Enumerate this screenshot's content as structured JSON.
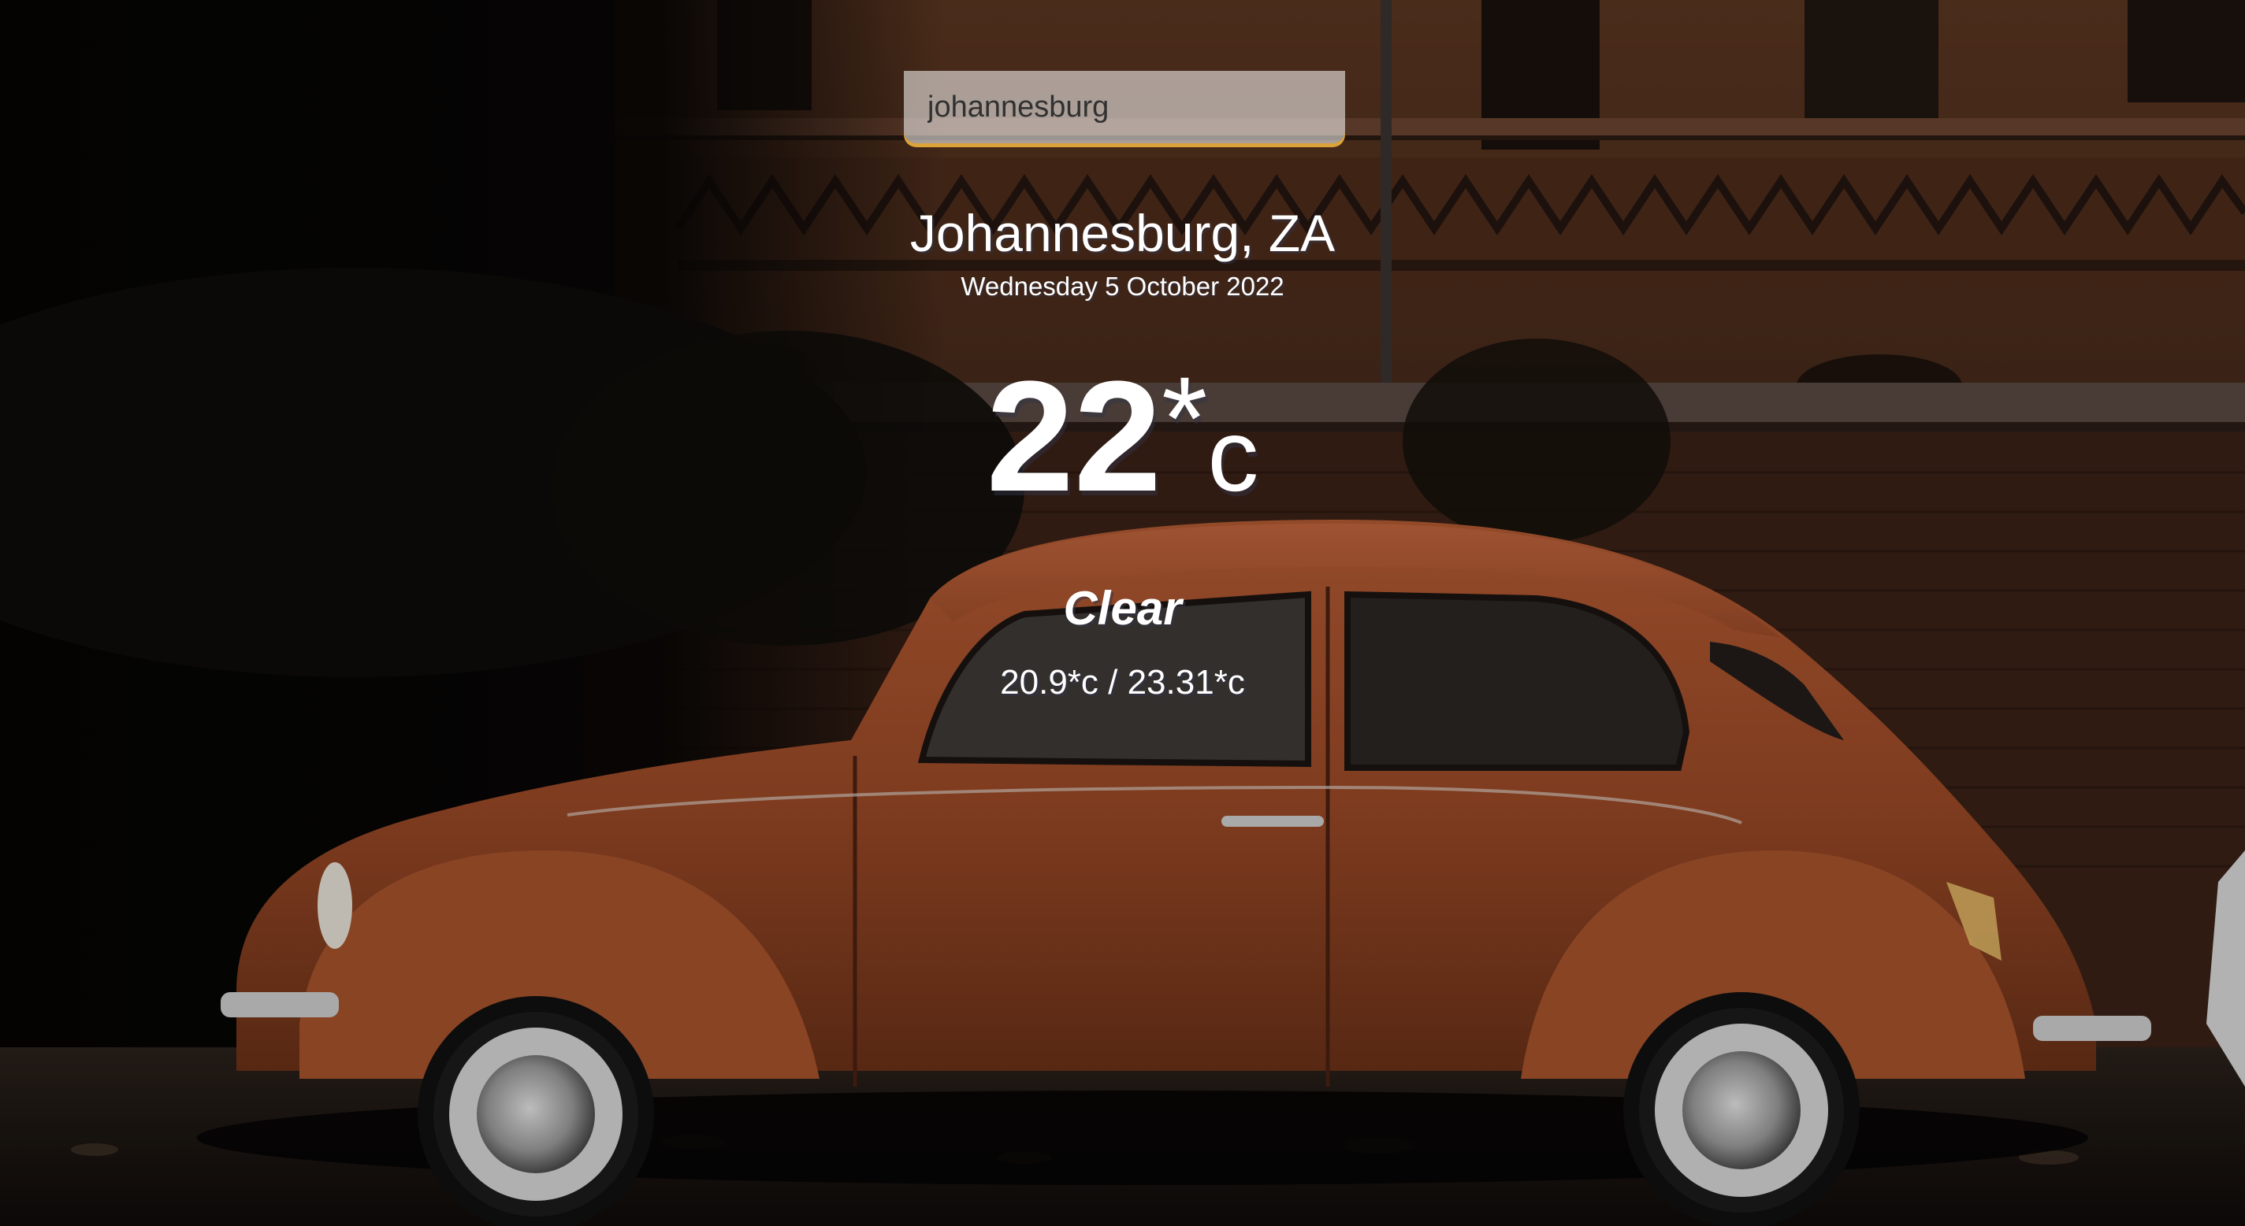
{
  "search": {
    "value": "johannesburg",
    "accent_color": "#dca339"
  },
  "location": {
    "city_country": "Johannesburg, ZA",
    "date": "Wednesday 5 October 2022"
  },
  "weather": {
    "temp_value": "22",
    "temp_degree_symbol": "*",
    "temp_unit": "c",
    "condition": "Clear",
    "low_high": "20.9*c / 23.31*c"
  },
  "background": {
    "subject": "orange vintage car in front of brick building",
    "car_color": "#a4512d",
    "wall_color": "#5a3521"
  }
}
